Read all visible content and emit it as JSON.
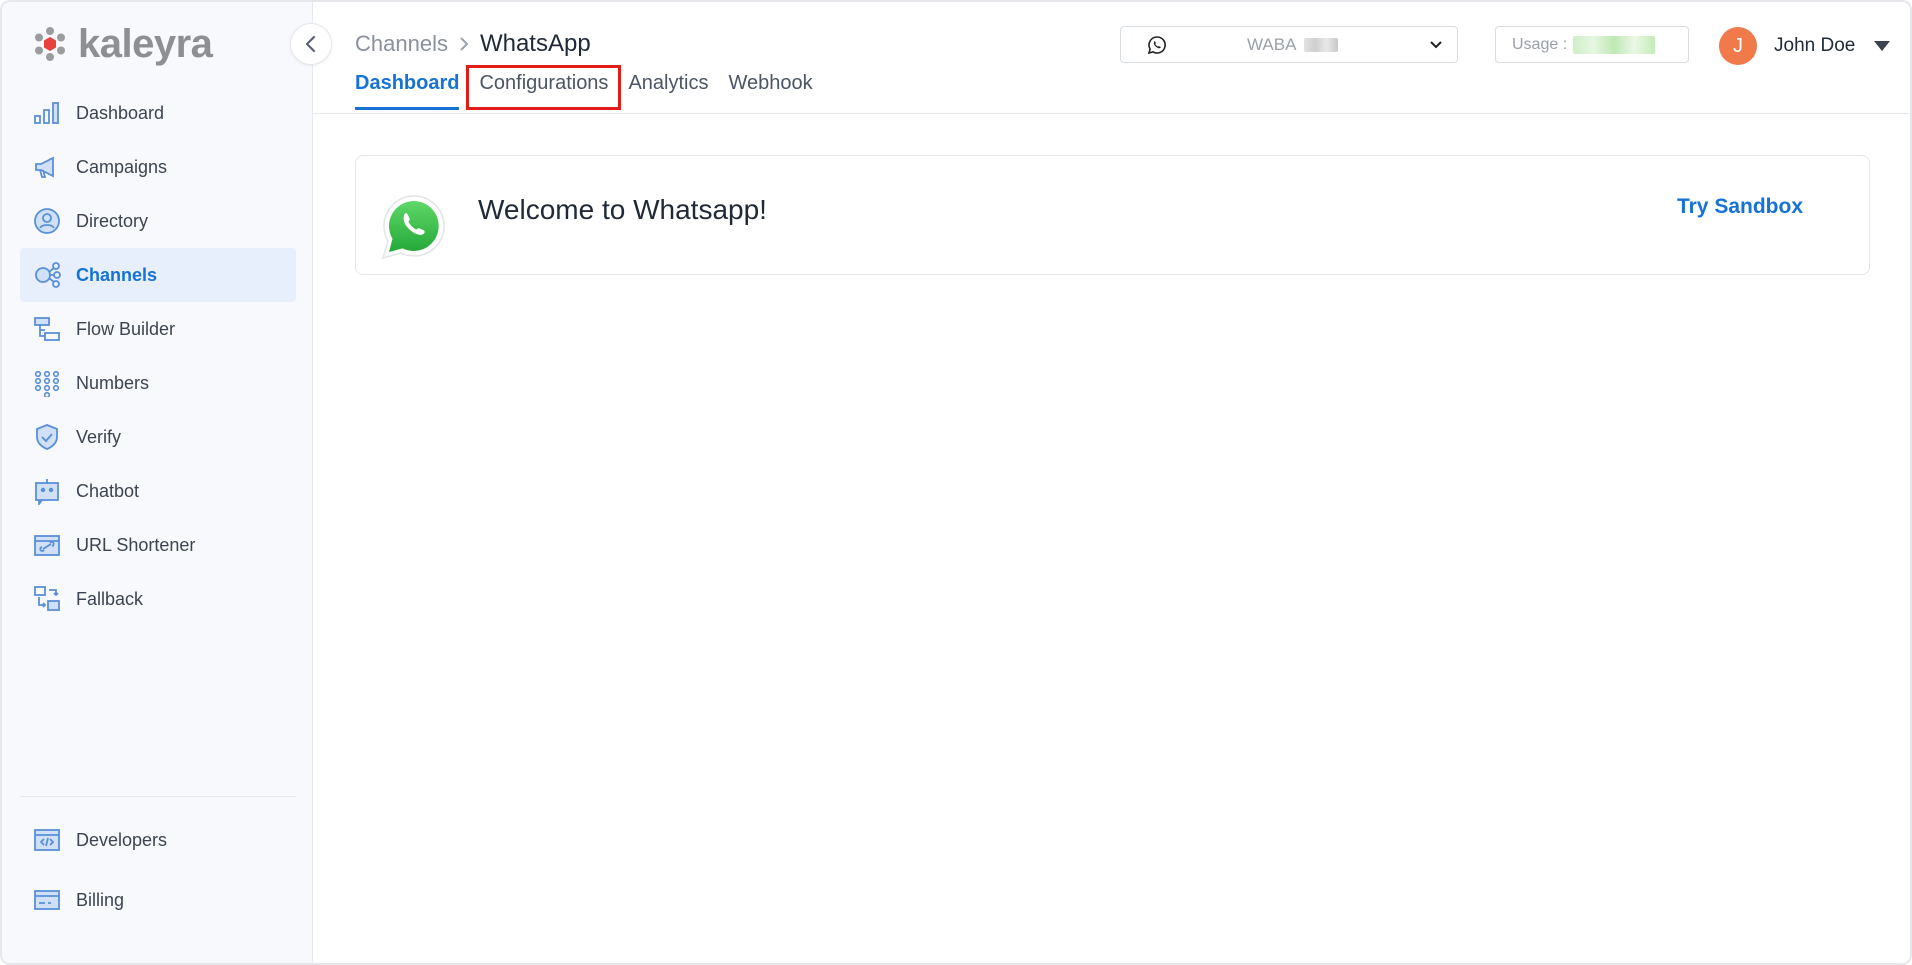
{
  "brand": {
    "name": "kaleyra"
  },
  "sidebar": {
    "items": [
      {
        "label": "Dashboard",
        "icon": "bar-chart-icon"
      },
      {
        "label": "Campaigns",
        "icon": "megaphone-icon"
      },
      {
        "label": "Directory",
        "icon": "contact-icon"
      },
      {
        "label": "Channels",
        "icon": "channels-icon",
        "active": true
      },
      {
        "label": "Flow Builder",
        "icon": "flow-icon"
      },
      {
        "label": "Numbers",
        "icon": "dialpad-icon"
      },
      {
        "label": "Verify",
        "icon": "shield-check-icon"
      },
      {
        "label": "Chatbot",
        "icon": "robot-icon"
      },
      {
        "label": "URL Shortener",
        "icon": "link-icon"
      },
      {
        "label": "Fallback",
        "icon": "fallback-icon"
      }
    ],
    "bottom_items": [
      {
        "label": "Developers",
        "icon": "code-icon"
      },
      {
        "label": "Billing",
        "icon": "credit-card-icon"
      }
    ]
  },
  "header": {
    "breadcrumb": {
      "parent": "Channels",
      "current": "WhatsApp"
    },
    "tabs": [
      {
        "label": "Dashboard",
        "active": true
      },
      {
        "label": "Configurations",
        "highlighted": true
      },
      {
        "label": "Analytics"
      },
      {
        "label": "Webhook"
      }
    ],
    "waba": {
      "label": "WABA"
    },
    "usage": {
      "label": "Usage :"
    },
    "user": {
      "initial": "J",
      "name": "John Doe"
    }
  },
  "main": {
    "welcome": "Welcome to Whatsapp!",
    "sandbox_link": "Try Sandbox"
  },
  "colors": {
    "accent": "#1672d6",
    "active_bg": "#e6effb",
    "avatar": "#f07a4a",
    "highlight": "#e21b1b",
    "whatsapp": "#2fb843"
  }
}
